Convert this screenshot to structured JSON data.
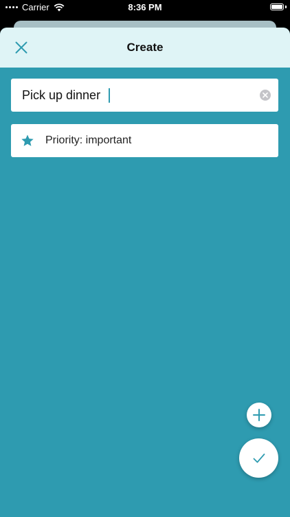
{
  "status_bar": {
    "carrier": "Carrier",
    "time": "8:36 PM"
  },
  "nav": {
    "title": "Create"
  },
  "title_field": {
    "value": "Pick up dinner"
  },
  "priority": {
    "label": "Priority: important"
  },
  "icons": {
    "close": "close-icon",
    "clear": "clear-icon",
    "star": "star-icon",
    "add": "plus-icon",
    "done": "checkmark-icon"
  },
  "colors": {
    "accent": "#2e9bb0",
    "nav_background": "#dff4f6",
    "card_background": "#ffffff"
  }
}
